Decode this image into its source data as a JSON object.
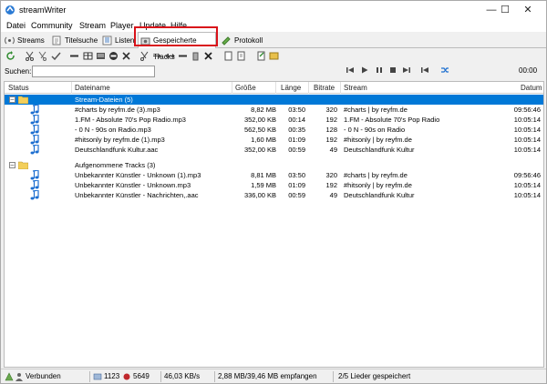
{
  "window": {
    "title": "streamWriter",
    "controls": [
      "—",
      "☐",
      "✕"
    ]
  },
  "menu": [
    "Datei",
    "Community",
    "Stream",
    "Player",
    "Update",
    "Hilfe"
  ],
  "tabs": [
    {
      "label": "Streams",
      "icon": "antenna-icon"
    },
    {
      "label": "Titelsuche",
      "icon": "text-search-icon"
    },
    {
      "label": "Listen",
      "icon": "list-icon"
    },
    {
      "label": "Gespeicherte Tracks",
      "icon": "saved-tracks-icon",
      "active": true
    },
    {
      "label": "Protokoll",
      "icon": "log-icon"
    }
  ],
  "search": {
    "label": "Suchen:",
    "value": "",
    "placeholder": ""
  },
  "player": {
    "time": "00:00",
    "volume_fraction": 0.05,
    "seek_fraction": 0.0
  },
  "table": {
    "columns": [
      "Status",
      "Dateiname",
      "Größe",
      "Länge",
      "Bitrate",
      "Stream",
      "Datum"
    ],
    "groups": [
      {
        "title": "Stream-Dateien (5)",
        "selected": true,
        "rows": [
          {
            "name": "#charts    by reyfm.de (3).mp3",
            "size": "8,82 MB",
            "length": "03:50",
            "bitrate": "320",
            "stream": "#charts | by reyfm.de",
            "date": "09:56:46"
          },
          {
            "name": "1.FM - Absolute 70's Pop Radio.mp3",
            "size": "352,00 KB",
            "length": "00:14",
            "bitrate": "192",
            "stream": "1.FM - Absolute 70's Pop Radio",
            "date": "10:05:14"
          },
          {
            "name": "- 0 N - 90s on Radio.mp3",
            "size": "562,50 KB",
            "length": "00:35",
            "bitrate": "128",
            "stream": "- 0 N - 90s on Radio",
            "date": "10:05:14"
          },
          {
            "name": "#hitsonly    by reyfm.de (1).mp3",
            "size": "1,60 MB",
            "length": "01:09",
            "bitrate": "192",
            "stream": "#hitsonly | by reyfm.de",
            "date": "10:05:14"
          },
          {
            "name": "Deutschlandfunk Kultur.aac",
            "size": "352,00 KB",
            "length": "00:59",
            "bitrate": "49",
            "stream": "Deutschlandfunk Kultur",
            "date": "10:05:14"
          }
        ]
      },
      {
        "title": "Aufgenommene Tracks (3)",
        "selected": false,
        "rows": [
          {
            "name": "Unbekannter Künstler - Unknown (1).mp3",
            "size": "8,81 MB",
            "length": "03:50",
            "bitrate": "320",
            "stream": "#charts | by reyfm.de",
            "date": "09:56:46"
          },
          {
            "name": "Unbekannter Künstler - Unknown.mp3",
            "size": "1,59 MB",
            "length": "01:09",
            "bitrate": "192",
            "stream": "#hitsonly | by reyfm.de",
            "date": "10:05:14"
          },
          {
            "name": "Unbekannter Künstler - Nachrichten,.aac",
            "size": "336,00 KB",
            "length": "00:59",
            "bitrate": "49",
            "stream": "Deutschlandfunk Kultur",
            "date": "10:05:14"
          }
        ]
      }
    ]
  },
  "status": {
    "connection": "Verbunden",
    "clients": "1123",
    "recordings": "5649",
    "speed": "46,03 KB/s",
    "received": "2,88 MB/39,46 MB empfangen",
    "saved": "2/5 Lieder gespeichert"
  },
  "colors": {
    "selection": "#0078d7",
    "highlight_box": "#d9121a",
    "music_note": "#1e6fd0"
  }
}
